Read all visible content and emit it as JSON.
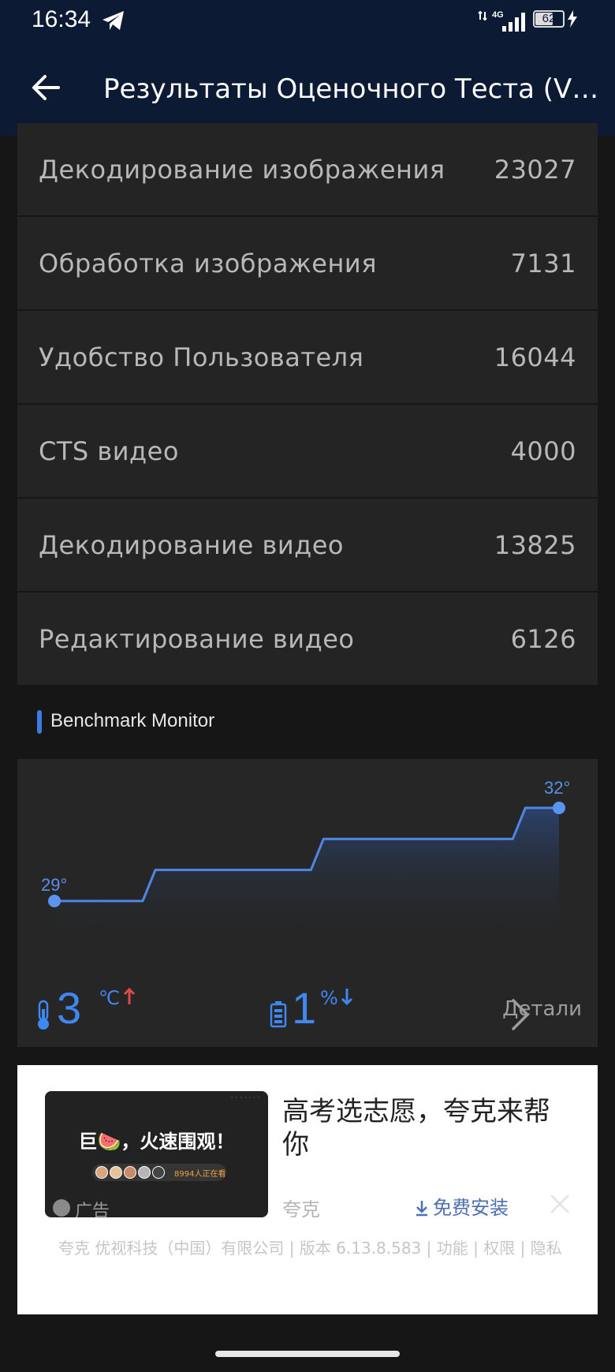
{
  "status_bar": {
    "time": "16:34",
    "network": "4G",
    "battery": "62"
  },
  "app_bar": {
    "title": "Результаты Оценочного Теста (V10..."
  },
  "rows": [
    {
      "label": "Декодирование изображения",
      "value": "23027"
    },
    {
      "label": "Обработка изображения",
      "value": "7131"
    },
    {
      "label": "Удобство Пользователя",
      "value": "16044"
    },
    {
      "label": "CTS видео",
      "value": "4000"
    },
    {
      "label": "Декодирование видео",
      "value": "13825"
    },
    {
      "label": "Редактирование видео",
      "value": "6126"
    }
  ],
  "monitor": {
    "section_title": "Benchmark Monitor",
    "temp_start": "29°",
    "temp_end": "32°",
    "temp_change": "3",
    "temp_unit": "℃",
    "battery_change": "1",
    "battery_unit": "%",
    "details_label": "Детали",
    "accent_color": "#3f87f1"
  },
  "chart_data": {
    "type": "area",
    "y": [
      29,
      29,
      29,
      30,
      30,
      30,
      30,
      30,
      31,
      31,
      31,
      31,
      31,
      31,
      32,
      32
    ],
    "labels": [
      "29°",
      "32°"
    ]
  },
  "ad": {
    "image_headline": "巨🍉，火速围观！",
    "image_count": "8994人正在看",
    "image_tag": "广告",
    "title": "高考选志愿，夸克来帮你",
    "brand": "夸克",
    "install_label": "免费安装",
    "footer": "夸克 优视科技（中国）有限公司 | 版本 6.13.8.583 | 功能 | 权限 | 隐私"
  }
}
